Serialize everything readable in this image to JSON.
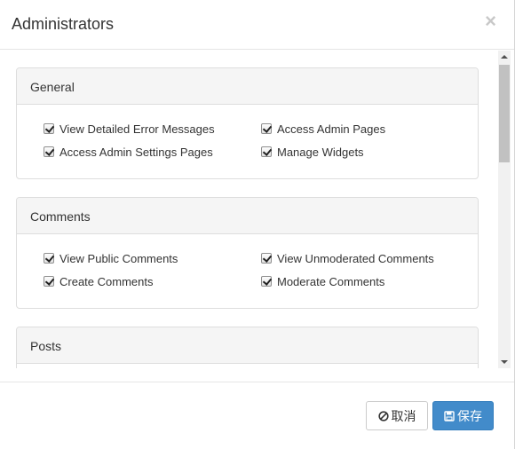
{
  "dialog": {
    "title": "Administrators",
    "close_symbol": "×"
  },
  "sections": [
    {
      "title": "General",
      "permissions": [
        {
          "label": "View Detailed Error Messages",
          "checked": true
        },
        {
          "label": "Access Admin Pages",
          "checked": true
        },
        {
          "label": "Access Admin Settings Pages",
          "checked": true
        },
        {
          "label": "Manage Widgets",
          "checked": true
        }
      ]
    },
    {
      "title": "Comments",
      "permissions": [
        {
          "label": "View Public Comments",
          "checked": true
        },
        {
          "label": "View Unmoderated Comments",
          "checked": true
        },
        {
          "label": "Create Comments",
          "checked": true
        },
        {
          "label": "Moderate Comments",
          "checked": true
        }
      ]
    },
    {
      "title": "Posts",
      "permissions": []
    }
  ],
  "footer": {
    "cancel_label": "取消",
    "cancel_icon": "ban-icon",
    "save_label": "保存",
    "save_icon": "floppy-disk-icon"
  },
  "colors": {
    "primary": "#428bca",
    "panel_heading_bg": "#f5f5f5",
    "border": "#dddddd"
  }
}
